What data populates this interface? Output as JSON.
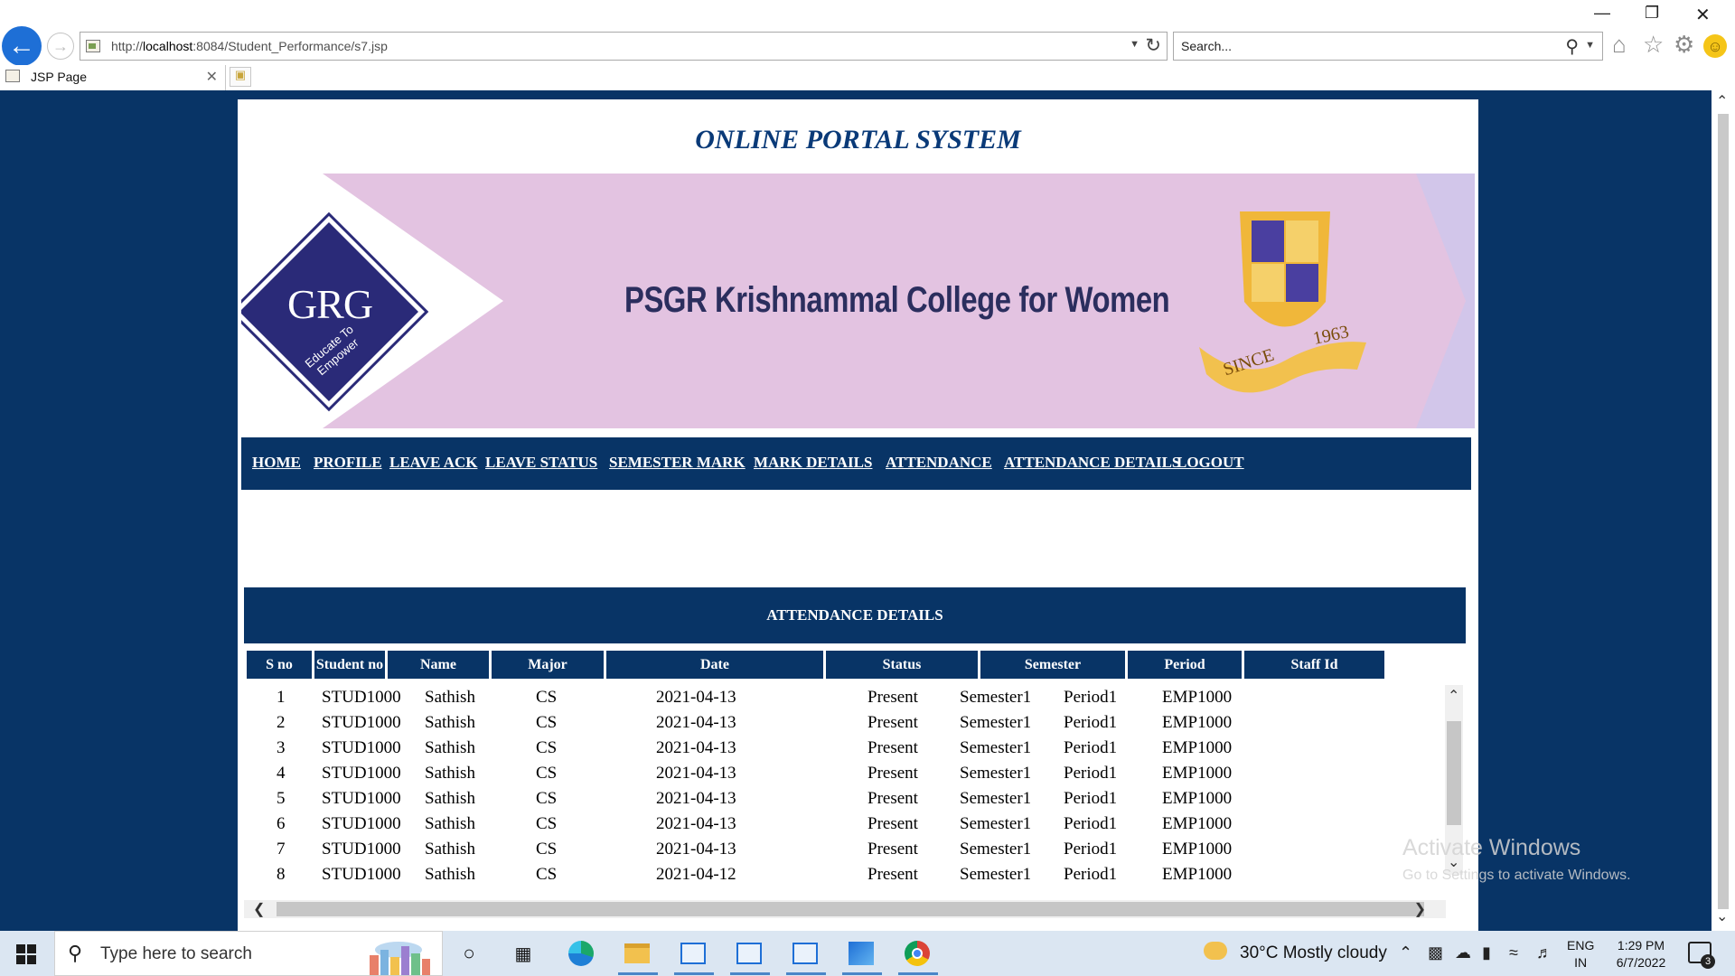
{
  "browser": {
    "url_prefix": "http://",
    "url_host": "localhost",
    "url_rest": ":8084/Student_Performance/s7.jsp",
    "search_placeholder": "Search...",
    "tab_title": "JSP Page"
  },
  "page": {
    "title": "ONLINE PORTAL SYSTEM",
    "banner": {
      "logo_text": "GRG",
      "logo_tagline": "Educate To Empower",
      "college_name": "PSGR Krishnammal College for Women",
      "crest_since": "SINCE",
      "crest_year": "1963"
    },
    "nav": [
      {
        "label": "HOME"
      },
      {
        "label": "PROFILE"
      },
      {
        "label": "LEAVE ACK"
      },
      {
        "label": "LEAVE STATUS"
      },
      {
        "label": "SEMESTER MARK"
      },
      {
        "label": "MARK DETAILS"
      },
      {
        "label": "ATTENDANCE"
      },
      {
        "label": "ATTENDANCE DETAILS"
      },
      {
        "label": "LOGOUT"
      }
    ],
    "attendance": {
      "heading": "ATTENDANCE DETAILS",
      "columns": [
        "S no",
        "Student no",
        "Name",
        "Major",
        "Date",
        "Status",
        "Semester",
        "Period",
        "Staff Id"
      ],
      "rows": [
        [
          "1",
          "STUD1000",
          "Sathish",
          "CS",
          "2021-04-13",
          "Present",
          "Semester1",
          "Period1",
          "EMP1000"
        ],
        [
          "2",
          "STUD1000",
          "Sathish",
          "CS",
          "2021-04-13",
          "Present",
          "Semester1",
          "Period1",
          "EMP1000"
        ],
        [
          "3",
          "STUD1000",
          "Sathish",
          "CS",
          "2021-04-13",
          "Present",
          "Semester1",
          "Period1",
          "EMP1000"
        ],
        [
          "4",
          "STUD1000",
          "Sathish",
          "CS",
          "2021-04-13",
          "Present",
          "Semester1",
          "Period1",
          "EMP1000"
        ],
        [
          "5",
          "STUD1000",
          "Sathish",
          "CS",
          "2021-04-13",
          "Present",
          "Semester1",
          "Period1",
          "EMP1000"
        ],
        [
          "6",
          "STUD1000",
          "Sathish",
          "CS",
          "2021-04-13",
          "Present",
          "Semester1",
          "Period1",
          "EMP1000"
        ],
        [
          "7",
          "STUD1000",
          "Sathish",
          "CS",
          "2021-04-13",
          "Present",
          "Semester1",
          "Period1",
          "EMP1000"
        ],
        [
          "8",
          "STUD1000",
          "Sathish",
          "CS",
          "2021-04-12",
          "Present",
          "Semester1",
          "Period1",
          "EMP1000"
        ]
      ]
    },
    "watermark": {
      "title": "Activate Windows",
      "subtitle": "Go to Settings to activate Windows."
    }
  },
  "taskbar": {
    "search_placeholder": "Type here to search",
    "weather": "30°C  Mostly cloudy",
    "lang_top": "ENG",
    "lang_bottom": "IN",
    "time": "1:29 PM",
    "date": "6/7/2022",
    "notification_count": "3"
  },
  "colors": {
    "brand_navy": "#083466",
    "title_blue": "#0a3a78",
    "banner_pink": "#e3c3e1",
    "banner_lavender": "#c9c2e5"
  }
}
